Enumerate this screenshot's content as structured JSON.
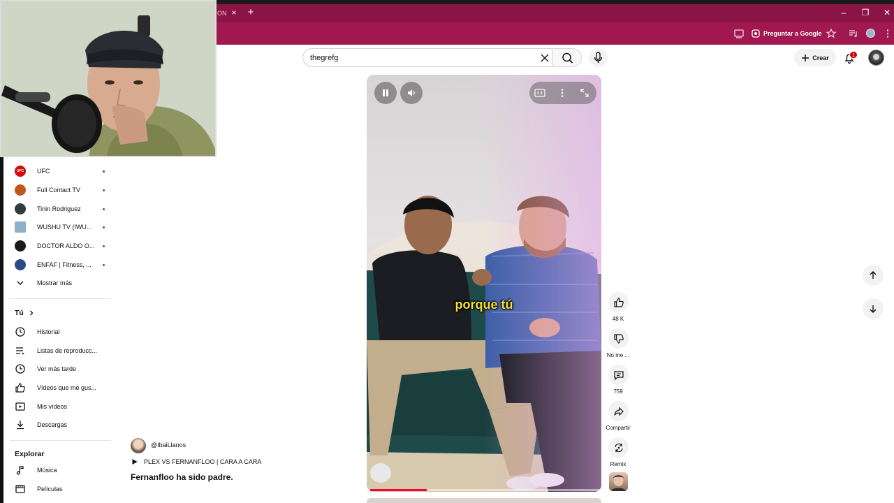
{
  "browser": {
    "tab_fragment": "ON",
    "tab_close": "×",
    "new_tab": "+",
    "ask_google_label": "Preguntar a Google",
    "window_controls": [
      "–",
      "❐",
      "✕"
    ]
  },
  "search": {
    "query": "thegrefg"
  },
  "header": {
    "create_label": "Crear",
    "notification_count": "1"
  },
  "sidebar": {
    "subscriptions": [
      {
        "label": "UFC",
        "avatar_color": "#d20a0a"
      },
      {
        "label": "Full Contact TV",
        "avatar_color": "#c2561f"
      },
      {
        "label": "Tinin Rodriguez",
        "avatar_color": "#2f3b3c"
      },
      {
        "label": "WUSHU TV (IWU...",
        "avatar_color": "#8fb0c9"
      },
      {
        "label": "DOCTOR ALDO O...",
        "avatar_color": "#1a1a1a"
      },
      {
        "label": "ENFAF | Fitness, ...",
        "avatar_color": "#2c4b86"
      }
    ],
    "show_more_label": "Mostrar más",
    "you_heading": "Tú",
    "you_items": [
      {
        "label": "Historial",
        "icon": "history-icon"
      },
      {
        "label": "Listas de reproducc...",
        "icon": "playlist-icon"
      },
      {
        "label": "Ver más tarde",
        "icon": "watch-later-icon"
      },
      {
        "label": "Vídeos que me gus...",
        "icon": "liked-videos-icon"
      },
      {
        "label": "Mis vídeos",
        "icon": "my-videos-icon"
      },
      {
        "label": "Descargas",
        "icon": "downloads-icon"
      }
    ],
    "explore_heading": "Explorar",
    "explore_items": [
      {
        "label": "Música",
        "icon": "music-icon"
      },
      {
        "label": "Películas",
        "icon": "movies-icon"
      }
    ]
  },
  "video": {
    "caption": "porque tú",
    "progress": 0.24
  },
  "actions": {
    "likes": "48 K",
    "dislike_label": "No me ...",
    "comments": "759",
    "share_label": "Compartir",
    "remix_label": "Remix"
  },
  "meta": {
    "channel": "@IbaiLlanos",
    "playlist": "PLEX VS FERNANFLOO | CARA A CARA",
    "title": "Fernanfloo ha sido padre."
  },
  "colors": {
    "browser_tabstrip": "#8a1544",
    "browser_toolbar": "#a0184f",
    "caption": "#f5e02b",
    "progress": "#ff0033",
    "subscription_dot": "#1c62b9",
    "notification_badge": "#cc0000"
  }
}
